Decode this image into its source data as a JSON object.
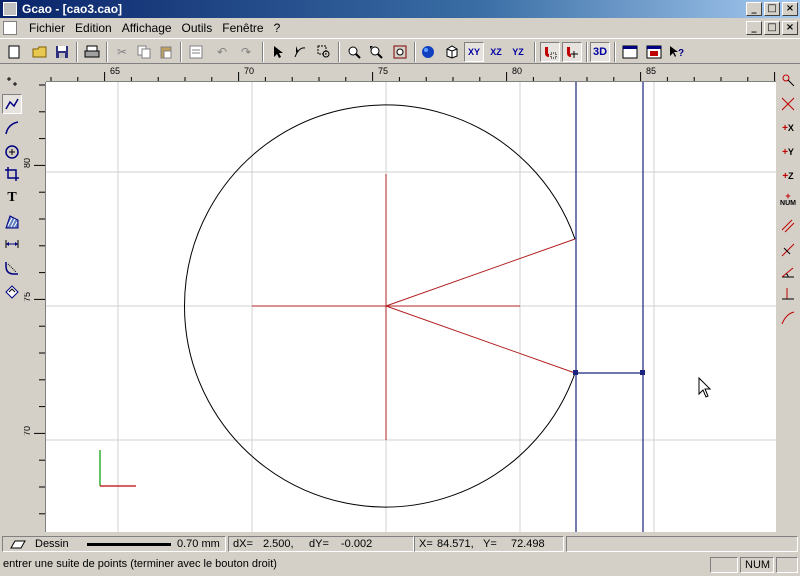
{
  "window": {
    "title": "Gcao - [cao3.cao]",
    "min_label": "_",
    "max_label": "□",
    "close_label": "×"
  },
  "menu": {
    "items": [
      {
        "label": "Fichier"
      },
      {
        "label": "Edition"
      },
      {
        "label": "Affichage"
      },
      {
        "label": "Outils"
      },
      {
        "label": "Fenêtre"
      },
      {
        "label": "?"
      }
    ]
  },
  "toolbar": {
    "btn_3d": "3D",
    "btn_xy": "XY",
    "btn_xz": "XZ",
    "btn_yz": "YZ"
  },
  "right_toolbar": {
    "x_label": "X",
    "y_label": "Y",
    "z_label": "Z",
    "num_label": "NUM"
  },
  "left_toolbar": {
    "text_tool": "T"
  },
  "rulers": {
    "h_labels": [
      "65",
      "70",
      "75",
      "80",
      "85"
    ],
    "v_labels": [
      "80",
      "75",
      "70"
    ]
  },
  "status": {
    "layer": "Dessin",
    "line_width": "0.70 mm",
    "dx_label": "dX=",
    "dx_value": "2.500,",
    "dy_label": "dY=",
    "dy_value": "-0.002",
    "coord_x_label": "X=",
    "coord_x_value": "84.571,",
    "coord_y_label": "Y=",
    "coord_y_value": "72.498",
    "message": "entrer une suite de points (terminer avec le bouton droit)",
    "num_indicator": "NUM"
  },
  "colors": {
    "title_start": "#0a246a",
    "accent_red": "#b22222",
    "accent_blue": "#1a237e",
    "axis_green": "#009900"
  }
}
